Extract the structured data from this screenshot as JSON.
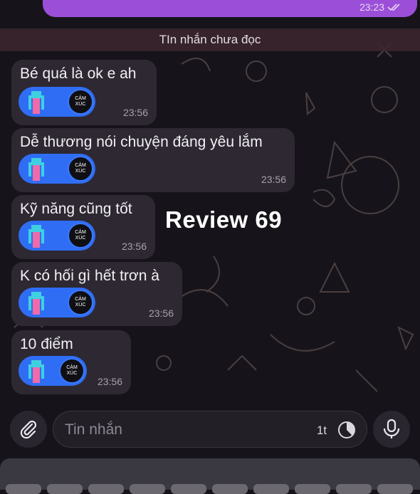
{
  "outgoing": {
    "time": "23:23"
  },
  "unread_banner": "TIn nhắn chưa đọc",
  "messages": [
    {
      "text": "Bé quá là ok e ah",
      "time": "23:56"
    },
    {
      "text": "Dễ thương nói chuyện đáng yêu lắm",
      "time": "23:56"
    },
    {
      "text": "Kỹ năng cũng tốt",
      "time": "23:56"
    },
    {
      "text": "K có hối gì hết trơn à",
      "time": "23:56"
    },
    {
      "text": "10 điểm",
      "time": "23:56"
    }
  ],
  "sticker": {
    "line1": "CẢM",
    "line2": "XÚC"
  },
  "overlay": "Review 69",
  "composer": {
    "placeholder": "Tin nhắn",
    "timer": "1t"
  },
  "colors": {
    "outgoing_bubble": "#9b4fd9",
    "incoming_bubble": "#2d2832",
    "sticker_blue": "#2f6df5"
  },
  "icons": {
    "attach": "paperclip-icon",
    "mic": "microphone-icon",
    "timer": "clock-icon",
    "read": "double-check-icon"
  }
}
